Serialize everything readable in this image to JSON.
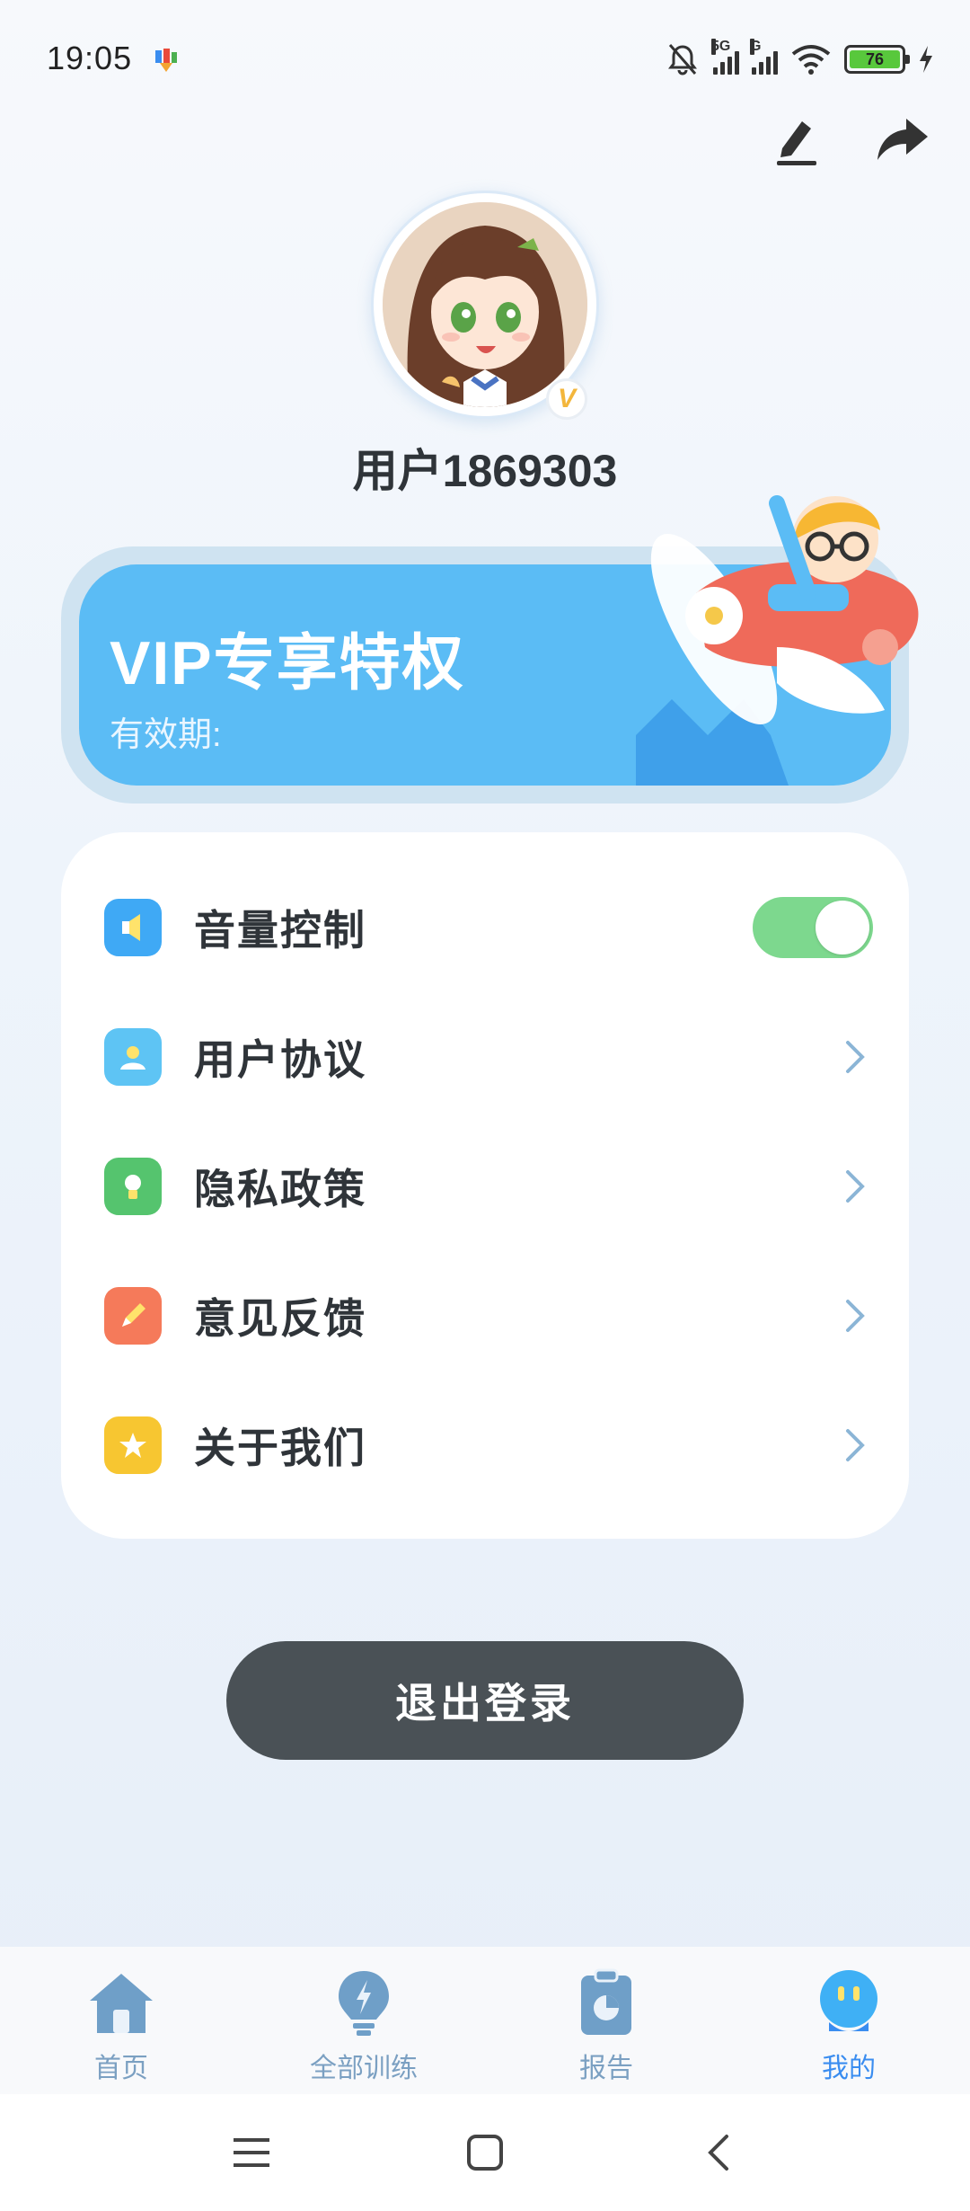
{
  "status_bar": {
    "time": "19:05",
    "network_1": "5G",
    "network_2": "G",
    "battery": "76",
    "icons": [
      "app-notification-icon",
      "mute-bell-icon",
      "signal-icon",
      "wifi-icon",
      "battery-icon",
      "charging-icon"
    ]
  },
  "header": {
    "actions": [
      "edit-icon",
      "share-icon"
    ]
  },
  "profile": {
    "username": "用户1869303",
    "vip_badge": "V"
  },
  "vip_card": {
    "title": "VIP专享特权",
    "expiry_label": "有效期:"
  },
  "menu": {
    "items": [
      {
        "label": "音量控制",
        "icon": "speaker-icon",
        "icon_color": "#3fa9f5",
        "control": "toggle",
        "toggle_on": true
      },
      {
        "label": "用户协议",
        "icon": "user-agreement-icon",
        "icon_color": "#5ec4f4",
        "control": "chevron"
      },
      {
        "label": "隐私政策",
        "icon": "lightbulb-icon",
        "icon_color": "#55c46e",
        "control": "chevron"
      },
      {
        "label": "意见反馈",
        "icon": "pencil-icon",
        "icon_color": "#f57a5a",
        "control": "chevron"
      },
      {
        "label": "关于我们",
        "icon": "star-icon",
        "icon_color": "#f7c631",
        "control": "chevron"
      }
    ]
  },
  "logout_label": "退出登录",
  "tabbar": {
    "tabs": [
      {
        "label": "首页",
        "icon": "home-icon",
        "active": false
      },
      {
        "label": "全部训练",
        "icon": "bulb-bolt-icon",
        "active": false
      },
      {
        "label": "报告",
        "icon": "report-clipboard-icon",
        "active": false
      },
      {
        "label": "我的",
        "icon": "robot-face-icon",
        "active": true
      }
    ]
  },
  "colors": {
    "accent": "#5bbcf5",
    "toggle_on": "#7dd88e",
    "logout_bg": "#4a5156",
    "tab_inactive": "#7ba0c2",
    "tab_active": "#3a8df0"
  }
}
